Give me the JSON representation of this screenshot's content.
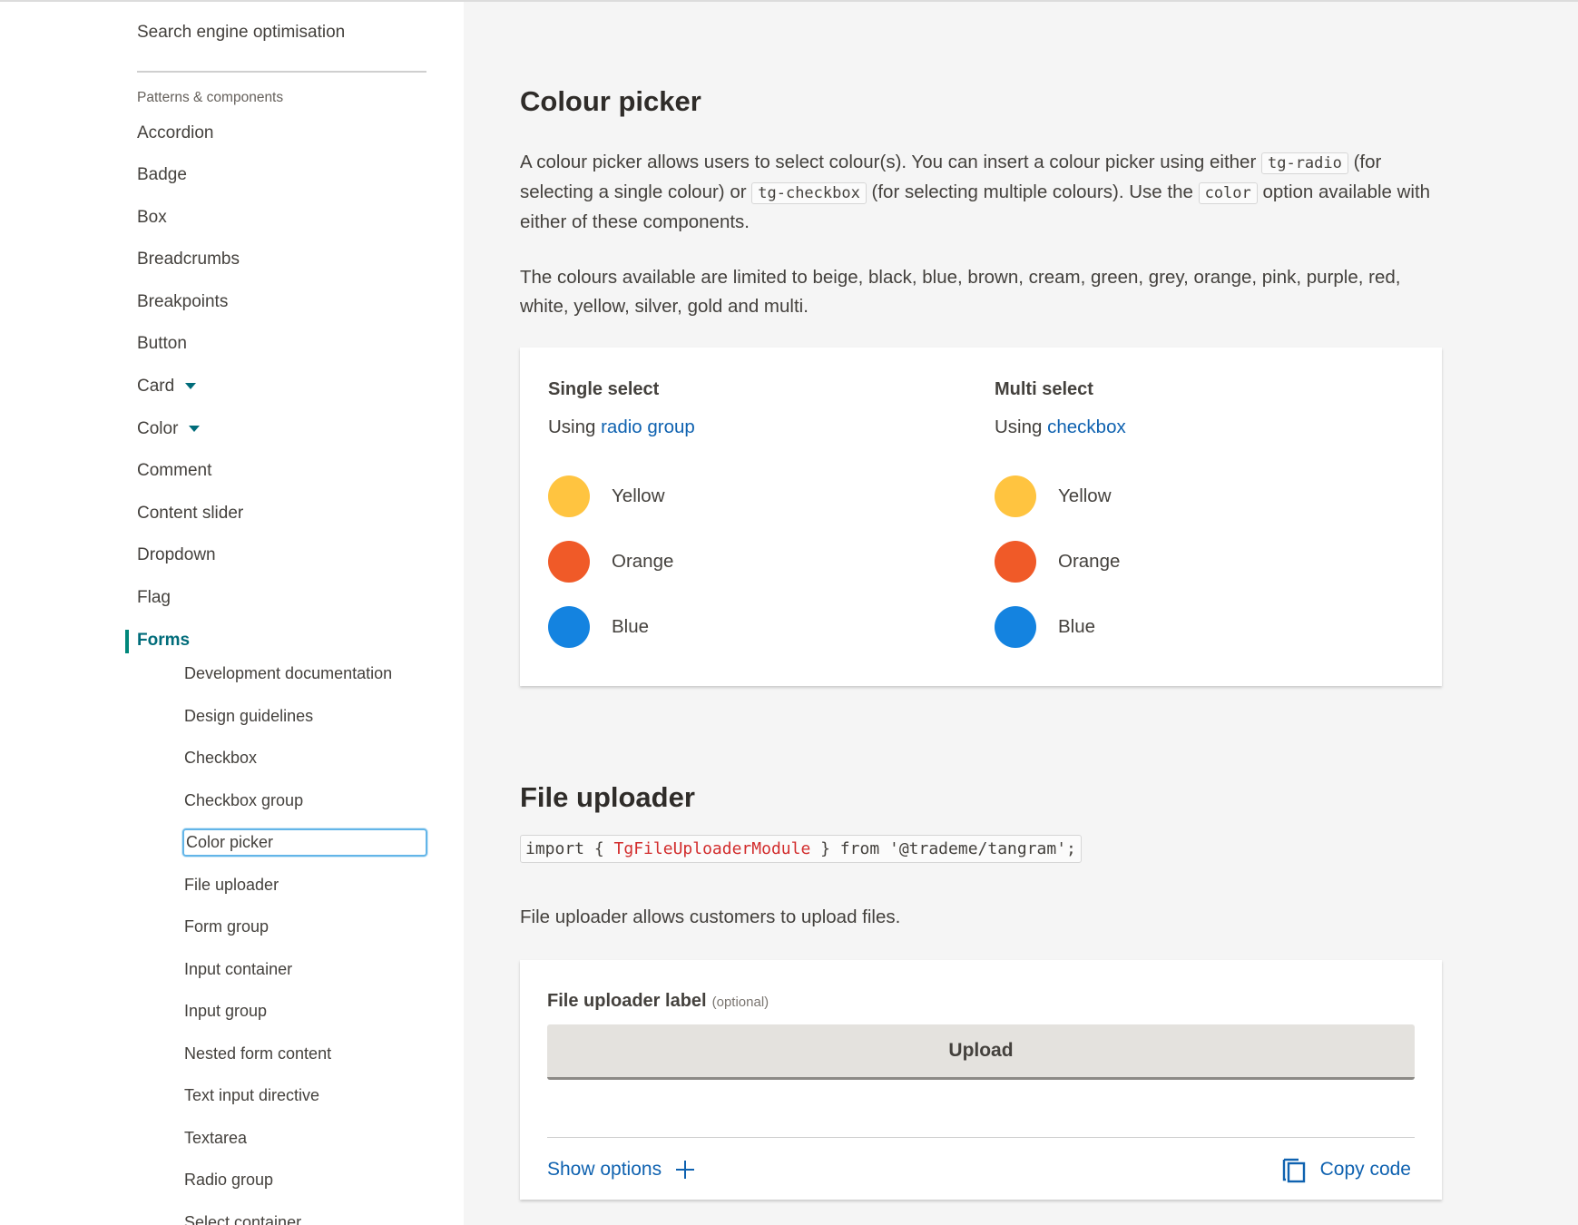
{
  "sidebar": {
    "top_item": "Search engine optimisation",
    "group_title": "Patterns & components",
    "items": [
      {
        "label": "Accordion"
      },
      {
        "label": "Badge"
      },
      {
        "label": "Box"
      },
      {
        "label": "Breadcrumbs"
      },
      {
        "label": "Breakpoints"
      },
      {
        "label": "Button"
      },
      {
        "label": "Card"
      },
      {
        "label": "Color"
      },
      {
        "label": "Comment"
      },
      {
        "label": "Content slider"
      },
      {
        "label": "Dropdown"
      },
      {
        "label": "Flag"
      },
      {
        "label": "Forms"
      }
    ],
    "sub_items": [
      {
        "label": "Development documentation"
      },
      {
        "label": "Design guidelines"
      },
      {
        "label": "Checkbox"
      },
      {
        "label": "Checkbox group"
      },
      {
        "label": "Color picker"
      },
      {
        "label": "File uploader"
      },
      {
        "label": "Form group"
      },
      {
        "label": "Input container"
      },
      {
        "label": "Input group"
      },
      {
        "label": "Nested form content"
      },
      {
        "label": "Text input directive"
      },
      {
        "label": "Textarea"
      },
      {
        "label": "Radio group"
      },
      {
        "label": "Select container"
      }
    ]
  },
  "colour_picker": {
    "title": "Colour picker",
    "intro": {
      "t1": "A colour picker allows users to select colour(s). You can insert a colour picker using either ",
      "code1": "tg-radio",
      "t2": " (for selecting a single colour) or ",
      "code2": "tg-checkbox",
      "t3": " (for selecting multiple colours). Use the ",
      "code3": "color",
      "t4": " option available with either of these components."
    },
    "colours_text": "The colours available are limited to beige, black, blue, brown, cream, green, grey, orange, pink, purple, red, white, yellow, silver, gold and multi.",
    "single": {
      "title": "Single select",
      "using": "Using ",
      "link": "radio group"
    },
    "multi": {
      "title": "Multi select",
      "using": "Using ",
      "link": "checkbox"
    },
    "options": [
      {
        "label": "Yellow",
        "color": "#ffc440"
      },
      {
        "label": "Orange",
        "color": "#f05a28"
      },
      {
        "label": "Blue",
        "color": "#1483e0"
      }
    ]
  },
  "file_uploader": {
    "title": "File uploader",
    "import": {
      "pre": "import { ",
      "module": "TgFileUploaderModule",
      "post": " } from '@trademe/tangram';"
    },
    "description": "File uploader allows customers to upload files.",
    "label": "File uploader label",
    "optional": "(optional)",
    "button": "Upload",
    "show_options": "Show options",
    "copy_code": "Copy code"
  },
  "colors": {
    "accent": "#006c7a",
    "link": "#0f62b0",
    "focus": "#63b5e8"
  }
}
